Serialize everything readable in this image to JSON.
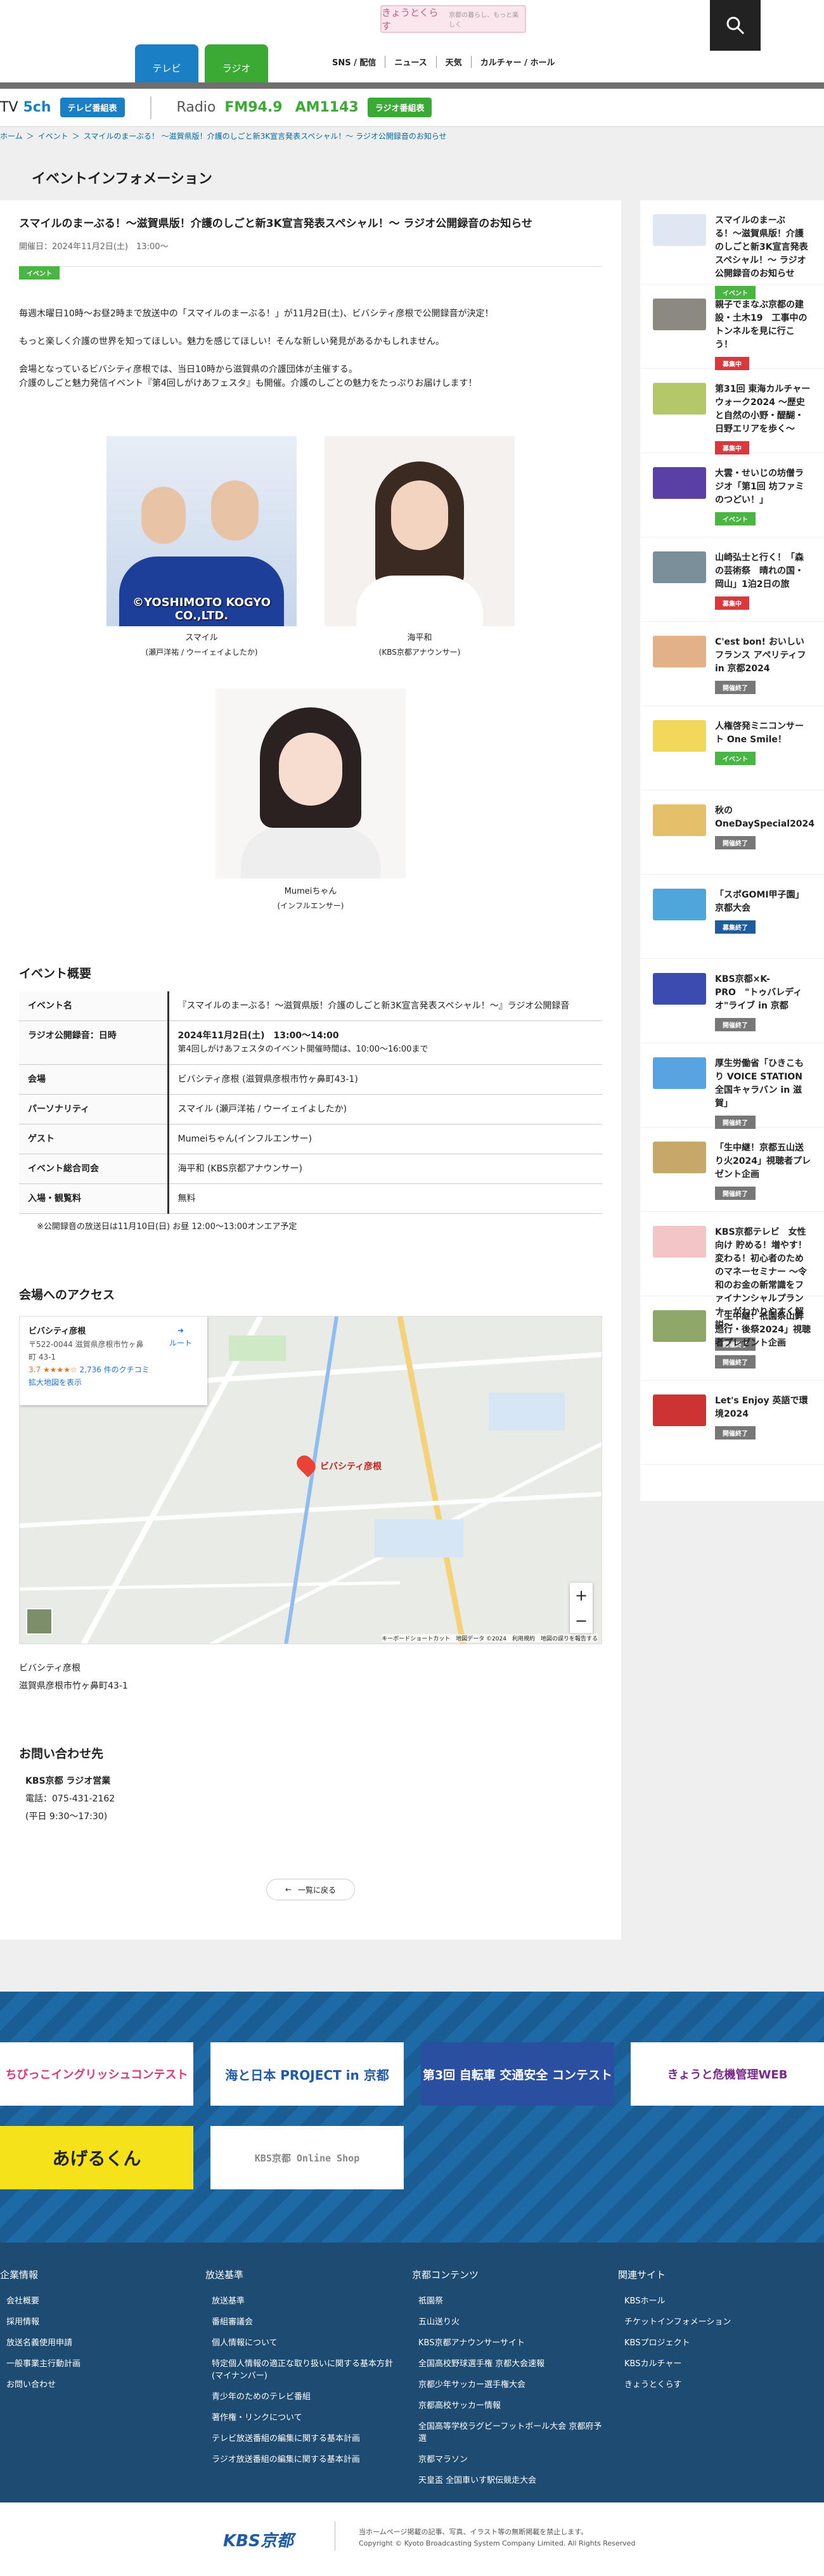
{
  "header": {
    "logo": "きょうとくらす",
    "logo_sub": "京都の暮らし、もっと楽しく",
    "tab_tv": "テレビ",
    "tab_radio": "ラジオ",
    "nav": [
      "SNS / 配信",
      "ニュース",
      "天気",
      "カルチャー / ホール"
    ]
  },
  "strip": {
    "tv": "TV",
    "tv_ch": "5ch",
    "tv_btn": "テレビ番組表",
    "radio": "Radio",
    "fm": "FM94.9",
    "am": "AM1143",
    "radio_btn": "ラジオ番組表"
  },
  "breadcrumb": [
    "ホーム",
    "＞",
    "イベント",
    "＞",
    "スマイルのまーぶる！ 〜滋賀県版！介護のしごと新3K宣言発表スペシャル！〜 ラジオ公開録音のお知らせ"
  ],
  "section_title": "イベントインフォメーション",
  "article": {
    "title": "スマイルのまーぶる！〜滋賀県版！介護のしごと新3K宣言発表スペシャル！〜 ラジオ公開録音のお知らせ",
    "date": "開催日：2024年11月2日(土)　13:00〜",
    "tag": "イベント",
    "p1": "毎週木曜日10時〜お昼2時まで放送中の「スマイルのまーぶる！」が11月2日(土)、ビバシティ彦根で公開録音が決定！",
    "p2": "もっと楽しく介護の世界を知ってほしい。魅力を感じてほしい！そんな新しい発見があるかもしれません。",
    "p3": "会場となっているビバシティ彦根では、当日10時から滋賀県の介護団体が主催する。",
    "p4": "介護のしごと魅力発信イベント『第4回しがけあフェスタ』も開催。介護のしごとの魅力をたっぷりお届けします！",
    "people": [
      {
        "name": "スマイル",
        "role": "(瀬戸洋祐 / ウーイェイよしたか)",
        "credit": "©YOSHIMOTO KOGYO CO.,LTD."
      },
      {
        "name": "海平和",
        "role": "(KBS京都アナウンサー)"
      },
      {
        "name": "Mumeiちゃん",
        "role": "(インフルエンサー)"
      }
    ]
  },
  "overview": {
    "heading": "イベント概要",
    "rows": [
      {
        "k": "イベント名",
        "v": "『スマイルのまーぶる！〜滋賀県版！介護のしごと新3K宣言発表スペシャル！〜』ラジオ公開録音"
      },
      {
        "k": "ラジオ公開録音：日時",
        "v": "2024年11月2日(土)　13:00〜14:00",
        "v2": "第4回しがけあフェスタのイベント開催時間は、10:00〜16:00まで"
      },
      {
        "k": "会場",
        "v": "ビバシティ彦根 (滋賀県彦根市竹ヶ鼻町43-1)"
      },
      {
        "k": "パーソナリティ",
        "v": "スマイル (瀬戸洋祐 / ウーイェイよしたか)"
      },
      {
        "k": "ゲスト",
        "v": "Mumeiちゃん(インフルエンサー)"
      },
      {
        "k": "イベント総合司会",
        "v": "海平和 (KBS京都アナウンサー)"
      },
      {
        "k": "入場・観覧料",
        "v": "無料"
      }
    ],
    "note": "※公開録音の放送日は11月10日(日) お昼 12:00〜13:00オンエア予定"
  },
  "access": {
    "heading": "会場へのアクセス",
    "map_place": "ビバシティ彦根",
    "map_addr": "〒522-0044 滋賀県彦根市竹ヶ鼻町 43-1",
    "map_rating": "3.7 ★★★★☆",
    "map_reviews": "2,736 件のクチコミ",
    "map_route": "ルート",
    "map_expand": "拡大地図を表示",
    "map_pin": "ビバシティ彦根",
    "place": "ビバシティ彦根",
    "addr": "滋賀県彦根市竹ヶ鼻町43-1",
    "map_footer": "キーボードショートカット　地図データ ©2024　利用規約　地図の誤りを報告する"
  },
  "contact": {
    "heading": "お問い合わせ先",
    "org": "KBS京都 ラジオ営業",
    "tel": "電話：075-431-2162",
    "hours": "(平日 9:30〜17:30)"
  },
  "back": "一覧に戻る",
  "sidebar": [
    {
      "t": "スマイルのまーぶる！〜滋賀県版！介護のしごと新3K宣言発表スペシャル！〜 ラジオ公開録音のお知らせ",
      "tag": "イベント",
      "c": "#4bb544"
    },
    {
      "t": "親子でまなぶ京都の建設・土木19　工事中のトンネルを見に行こう！",
      "tag": "募集中",
      "c": "#d9393c"
    },
    {
      "t": "第31回 東海カルチャーウォーク2024 〜歴史と自然の小野・醍醐・日野エリアを歩く〜",
      "tag": "募集中",
      "c": "#d9393c"
    },
    {
      "t": "大雲・せいじの坊僧ラジオ「第1回 坊ファミのつどい！」",
      "tag": "イベント",
      "c": "#4bb544"
    },
    {
      "t": "山崎弘士と行く！「森の芸術祭　晴れの国・岡山」1泊2日の旅",
      "tag": "募集中",
      "c": "#d9393c"
    },
    {
      "t": "C'est bon! おいしいフランス アペリティフ in 京都2024",
      "tag": "開催終了",
      "c": "#777"
    },
    {
      "t": "人権啓発ミニコンサート One Smile！",
      "tag": "イベント",
      "c": "#4bb544"
    },
    {
      "t": "秋の OneDaySpecial2024",
      "tag": "開催終了",
      "c": "#777"
    },
    {
      "t": "「スポGOMI甲子園」京都大会",
      "tag": "募集終了",
      "c": "#1f5c99"
    },
    {
      "t": "KBS京都×K-PRO　\"トゥバレディオ\"ライブ in 京都",
      "tag": "開催終了",
      "c": "#777"
    },
    {
      "t": "厚生労働省「ひきこもり VOICE STATION 全国キャラバン in 滋賀」",
      "tag": "開催終了",
      "c": "#777"
    },
    {
      "t": "「生中継！京都五山送り火2024」視聴者プレゼント企画",
      "tag": "開催終了",
      "c": "#777"
    },
    {
      "t": "KBS京都テレビ　女性向け 貯める！増やす！変わる！初心者のためのマネーセミナー 〜令和のお金の新常識をファイナンシャルプランナーがわかりやすく解説〜",
      "tag": "開催終了",
      "c": "#777"
    },
    {
      "t": "「生中継！祇園祭山鉾巡行・後祭2024」視聴者プレゼント企画",
      "tag": "開催終了",
      "c": "#777"
    },
    {
      "t": "Let's Enjoy 英語で環境2024",
      "tag": "開催終了",
      "c": "#777"
    }
  ],
  "banners": [
    "ちびっこイングリッシュコンテスト",
    "海と日本 PROJECT in 京都",
    "第3回 自転車 交通安全 コンテスト",
    "きょうと危機管理WEB",
    "あげるくん",
    "KBS京都 Online Shop"
  ],
  "footer": {
    "cols": [
      {
        "h": "企業情報",
        "items": [
          "会社概要",
          "採用情報",
          "放送名義使用申請",
          "一般事業主行動計画",
          "お問い合わせ"
        ]
      },
      {
        "h": "放送基準",
        "items": [
          "放送基準",
          "番組審議会",
          "個人情報について",
          "特定個人情報の適正な取り扱いに関する基本方針(マイナンバー)",
          "青少年のためのテレビ番組",
          "著作権・リンクについて",
          "テレビ放送番組の編集に関する基本計画",
          "ラジオ放送番組の編集に関する基本計画"
        ]
      },
      {
        "h": "京都コンテンツ",
        "items": [
          "祇園祭",
          "五山送り火",
          "KBS京都アナウンサーサイト",
          "全国高校野球選手権 京都大会速報",
          "京都少年サッカー選手権大会",
          "京都高校サッカー情報",
          "全国高等学校ラグビーフットボール大会 京都府予選",
          "京都マラソン",
          "天皇盃 全国車いす駅伝競走大会"
        ]
      },
      {
        "h": "関連サイト",
        "items": [
          "KBSホール",
          "チケットインフォメーション",
          "KBSプロジェクト",
          "KBSカルチャー",
          "きょうとくらす"
        ]
      }
    ],
    "logo": "KBS京都",
    "copy1": "当ホームページ掲載の記事、写真、イラスト等の無断掲載を禁止します。",
    "copy2": "Copyright © Kyoto Broadcasting System Company Limited. All Rights Reserved"
  },
  "colors": {
    "tv_tab": "#1a7fc4",
    "radio_tab": "#3aaa35",
    "link": "#0069a8",
    "footer_dark": "#1e4b72"
  }
}
